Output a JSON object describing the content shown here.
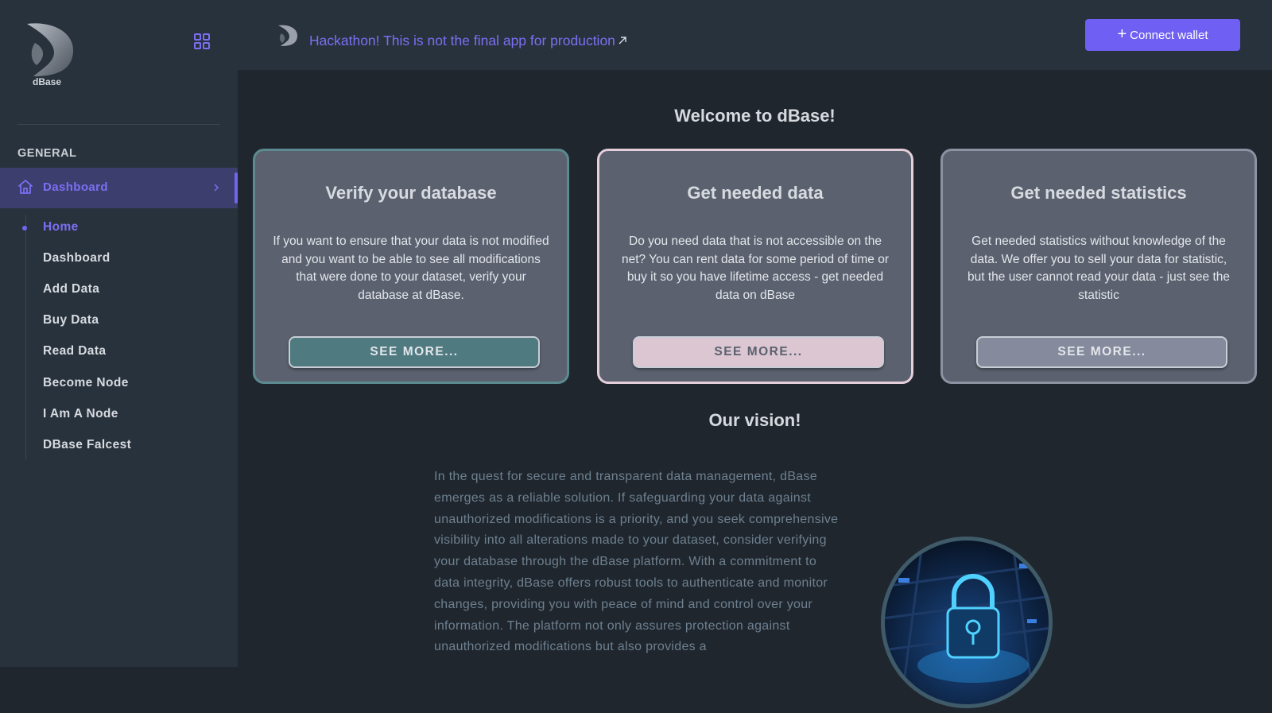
{
  "sidebar": {
    "logo_text": "dBase",
    "section_title": "GENERAL",
    "active_item": {
      "label": "Dashboard"
    },
    "subitems": [
      {
        "label": "Home",
        "active": true
      },
      {
        "label": "Dashboard",
        "active": false
      },
      {
        "label": "Add Data",
        "active": false
      },
      {
        "label": "Buy Data",
        "active": false
      },
      {
        "label": "Read Data",
        "active": false
      },
      {
        "label": "Become Node",
        "active": false
      },
      {
        "label": "I Am A Node",
        "active": false
      },
      {
        "label": "DBase Falcest",
        "active": false
      }
    ]
  },
  "header": {
    "notice": "Hackathon! This is not the final app for production",
    "connect_label": "Connect wallet"
  },
  "main": {
    "welcome": "Welcome to dBase!",
    "cards": [
      {
        "title": "Verify your database",
        "text": "If you want to ensure that your data is not modified and you want to be able to see all modifications that were done to your dataset, verify your database at dBase.",
        "button": "SEE MORE..."
      },
      {
        "title": "Get needed data",
        "text": "Do you need data that is not accessible on the net? You can rent data for some period of time or buy it so you have lifetime access - get needed data on dBase",
        "button": "SEE MORE..."
      },
      {
        "title": "Get needed statistics",
        "text": "Get needed statistics without knowledge of the data. We offer you to sell your data for statistic, but the user cannot read your data - just see the statistic",
        "button": "SEE MORE..."
      }
    ],
    "vision_title": "Our vision!",
    "vision_text": "In the quest for secure and transparent data management, dBase emerges as a reliable solution. If safeguarding your data against unauthorized modifications is a priority, and you seek comprehensive visibility into all alterations made to your dataset, consider verifying your database through the dBase platform. With a commitment to data integrity, dBase offers robust tools to authenticate and monitor changes, providing you with peace of mind and control over your information. The platform not only assures protection against unauthorized modifications but also provides a"
  },
  "colors": {
    "accent": "#6f5ff2",
    "sidebar_bg": "#28323c",
    "main_bg": "#1f262e",
    "card_bg": "#5b616f"
  },
  "icons": {
    "logo": "dbase-logo-icon",
    "grid": "grid-icon",
    "home": "home-icon",
    "chevron": "chevron-right-icon",
    "external": "external-link-icon",
    "plus": "plus-icon",
    "lock": "lock-image"
  }
}
